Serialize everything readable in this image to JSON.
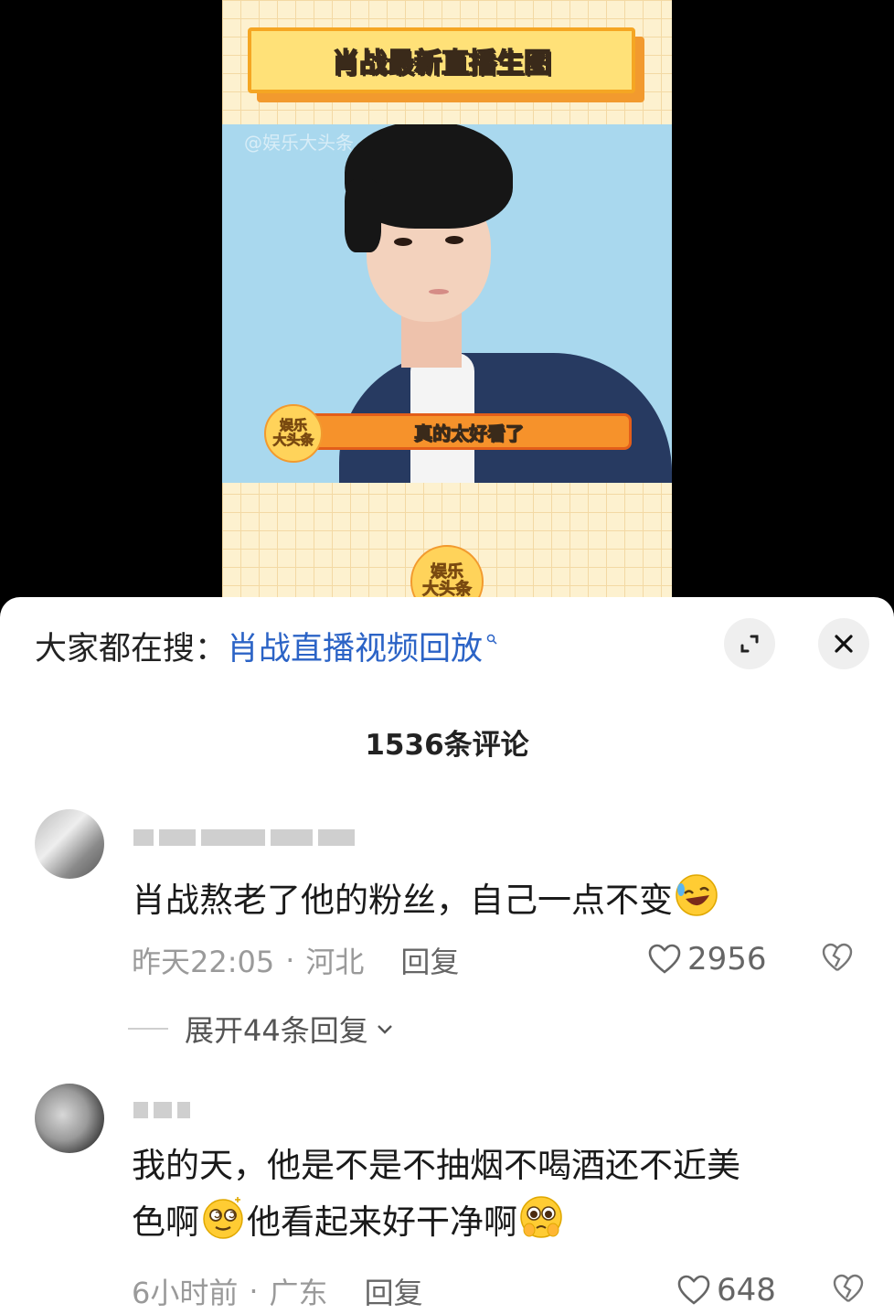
{
  "video": {
    "banner_title": "肖战最新直播生图",
    "watermark": "@娱乐大头条",
    "caption": "真的太好看了",
    "badge_line1": "娱乐",
    "badge_line2": "大头条"
  },
  "sheet": {
    "search_prefix": "大家都在搜：",
    "search_term": "肖战直播视频回放",
    "comment_count": "1536条评论",
    "comments": [
      {
        "text": "肖战熬老了他的粉丝，自己一点不变",
        "time": "昨天22:05",
        "location": "河北",
        "reply_label": "回复",
        "likes": "2956",
        "expand_replies": "展开44条回复"
      },
      {
        "text_line1": "我的天，他是不是不抽烟不喝酒还不近美",
        "text_part2a": "色啊",
        "text_part2b": "他看起来好干净啊",
        "time": "6小时前",
        "location": "广东",
        "reply_label": "回复",
        "likes": "648"
      }
    ]
  },
  "colors": {
    "link_blue": "#2b63c6",
    "banner_yellow": "#ffe178",
    "caption_orange": "#f6922b",
    "photo_background": "#a9d8ee"
  },
  "icons": [
    "search-mini-icon",
    "expand-icon",
    "close-icon",
    "heart-icon",
    "broken-heart-icon",
    "chevron-down-icon",
    "laughing-emoji",
    "dizzy-emoji",
    "pleading-emoji"
  ]
}
